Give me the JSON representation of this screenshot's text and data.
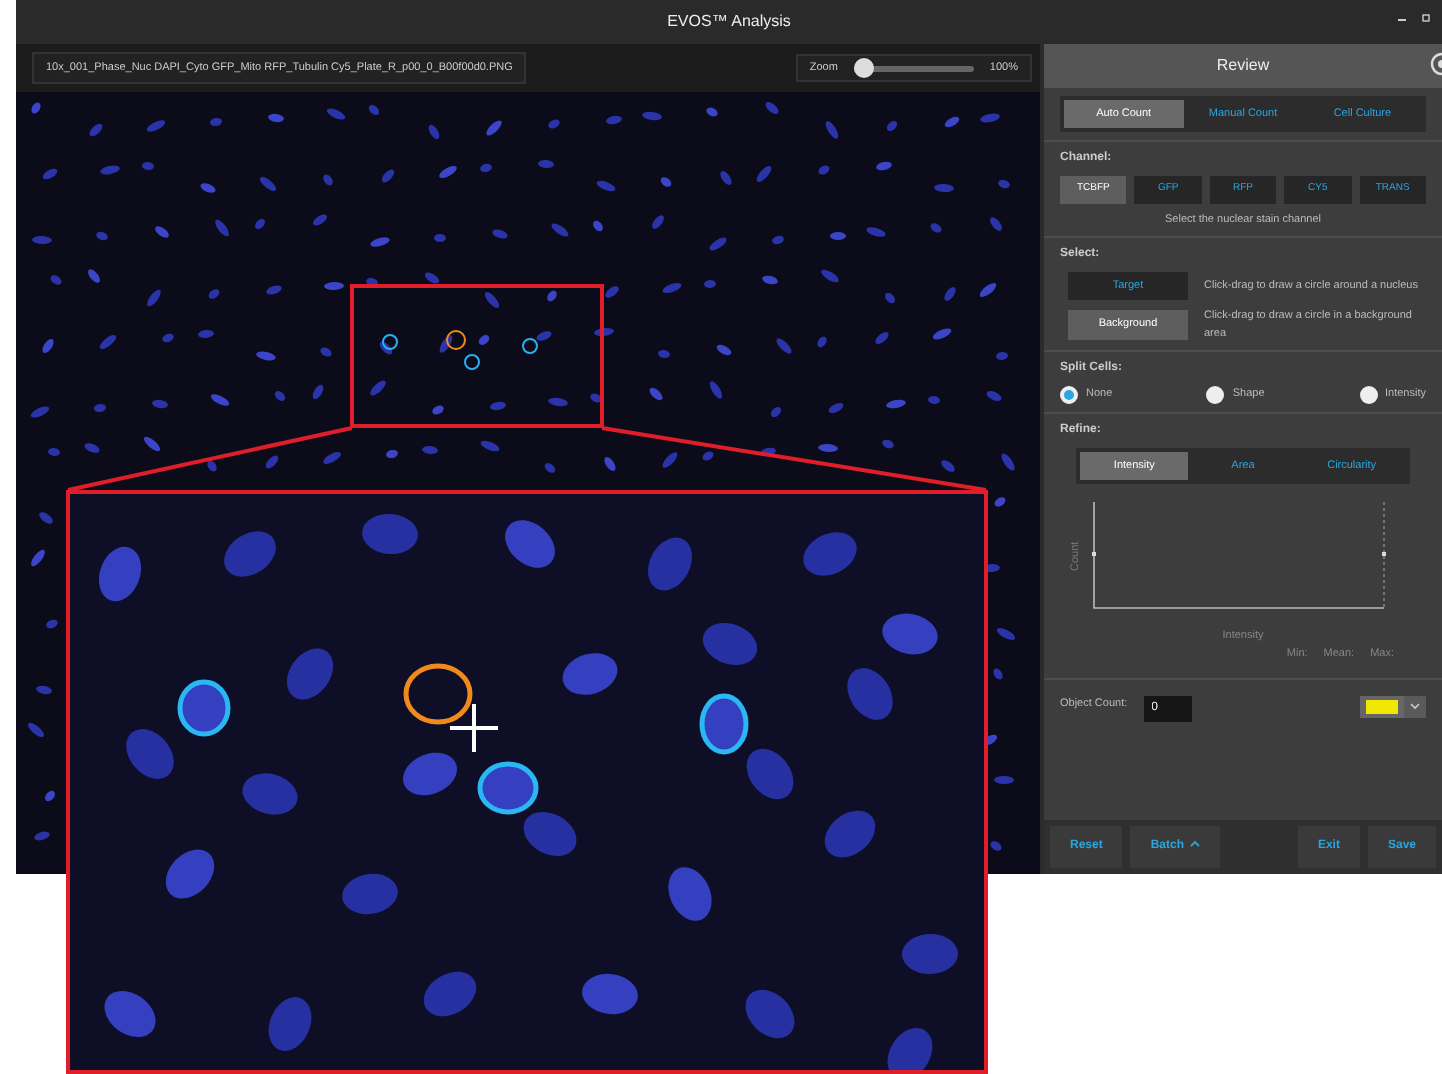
{
  "window": {
    "title": "EVOS™ Analysis"
  },
  "viewer": {
    "filename": "10x_001_Phase_Nuc DAPI_Cyto GFP_Mito RFP_Tubulin Cy5_Plate_R_p00_0_B00f00d0.PNG",
    "zoom": {
      "label": "Zoom",
      "level": 0.08,
      "reading": "100%"
    }
  },
  "panel": {
    "title": "Review",
    "mode_tabs": [
      {
        "label": "Auto Count",
        "selected": true
      },
      {
        "label": "Manual Count",
        "selected": false
      },
      {
        "label": "Cell Culture",
        "selected": false
      }
    ],
    "channel": {
      "label": "Channel:",
      "options": [
        {
          "label": "TCBFP",
          "selected": true
        },
        {
          "label": "GFP",
          "selected": false
        },
        {
          "label": "RFP",
          "selected": false
        },
        {
          "label": "CY5",
          "selected": false
        },
        {
          "label": "TRANS",
          "selected": false
        }
      ],
      "hint": "Select the nuclear stain channel"
    },
    "select": {
      "label": "Select:",
      "tools": [
        {
          "label": "Target",
          "selected": false,
          "hint": "Click-drag to draw a circle around a nucleus"
        },
        {
          "label": "Background",
          "selected": true,
          "hint": "Click-drag to draw a circle in a background area"
        }
      ]
    },
    "split_cells": {
      "label": "Split Cells:",
      "options": [
        {
          "label": "None",
          "selected": true
        },
        {
          "label": "Shape",
          "selected": false
        },
        {
          "label": "Intensity",
          "selected": false
        }
      ]
    },
    "refine": {
      "label": "Refine:",
      "tabs": [
        {
          "label": "Intensity",
          "selected": true
        },
        {
          "label": "Area",
          "selected": false
        },
        {
          "label": "Circularity",
          "selected": false
        }
      ],
      "ylabel": "Count",
      "xlabel": "Intensity",
      "stats": [
        "Min:",
        "Mean:",
        "Max:"
      ]
    },
    "object_count": {
      "label": "Object Count:",
      "value": "0",
      "color": "#f0e800"
    },
    "footer": [
      {
        "label": "Reset",
        "kind": "plain"
      },
      {
        "label": "Batch",
        "kind": "menu"
      },
      {
        "label": "Exit",
        "kind": "plain"
      },
      {
        "label": "Save",
        "kind": "plain"
      }
    ]
  }
}
